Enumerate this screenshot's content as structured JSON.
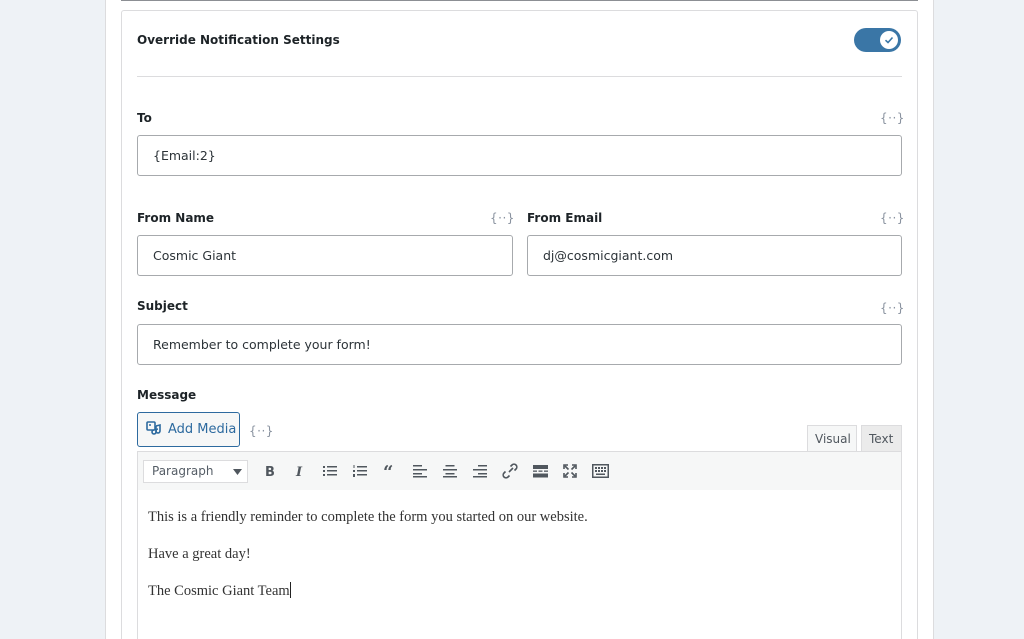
{
  "notification": {
    "override_label": "Override Notification Settings",
    "override_enabled": true
  },
  "merge_tag_glyph": "{··}",
  "to": {
    "label": "To",
    "value": "{Email:2}"
  },
  "from_name": {
    "label": "From Name",
    "value": "Cosmic Giant"
  },
  "from_email": {
    "label": "From Email",
    "value": "dj@cosmicgiant.com"
  },
  "subject": {
    "label": "Subject",
    "value": "Remember to complete your form!"
  },
  "message": {
    "label": "Message",
    "add_media_label": "Add Media",
    "tabs": {
      "visual": "Visual",
      "text": "Text"
    },
    "format_select": "Paragraph",
    "toolbar_icons": [
      "bold-icon",
      "italic-icon",
      "bulleted-list-icon",
      "numbered-list-icon",
      "blockquote-icon",
      "align-left-icon",
      "align-center-icon",
      "align-right-icon",
      "link-icon",
      "read-more-icon",
      "fullscreen-icon",
      "toolbar-toggle-icon"
    ],
    "paragraphs": [
      "This is a friendly reminder to complete the form you started on our website.",
      "Have a great day!",
      "The Cosmic Giant Team"
    ]
  },
  "colors": {
    "accent": "#3a76a6",
    "button_text": "#2d6a9f",
    "border": "#a7aaad"
  }
}
